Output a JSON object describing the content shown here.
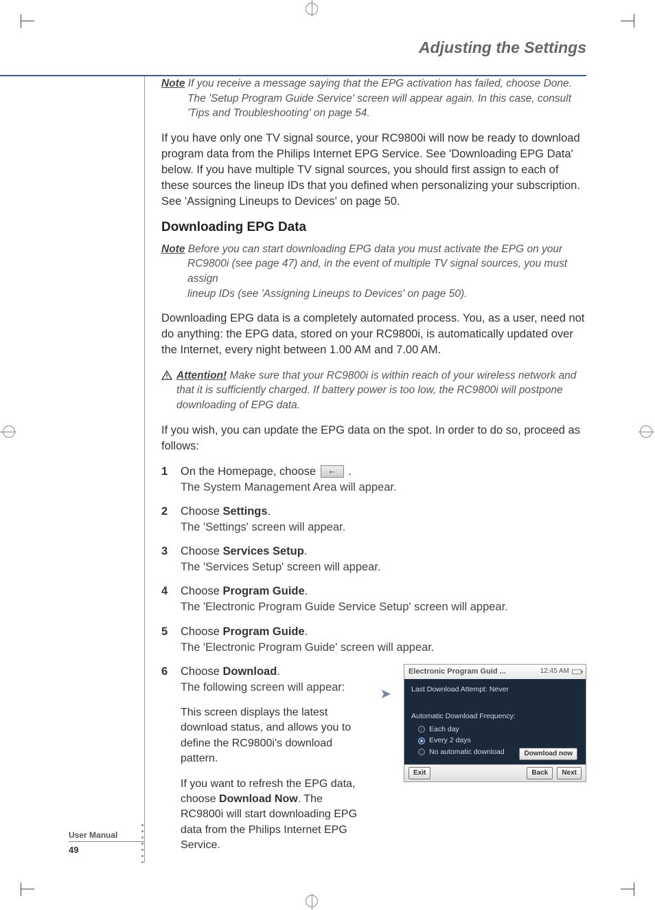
{
  "header": {
    "title": "Adjusting the Settings"
  },
  "note1": {
    "label": "Note",
    "line1": "If you receive a message saying that the EPG activation has failed, choose Done.",
    "line2": "The 'Setup Program Guide Service' screen will appear again. In this case, consult",
    "line3": "'Tips and Troubleshooting' on page 54."
  },
  "para1": "If you have only one TV signal source, your RC9800i will now be ready to download program data from the Philips Internet EPG Service. See 'Downloading EPG Data' below. If you have multiple TV signal sources, you should first assign to each of these sources the lineup IDs that you defined when personalizing your subscription. See 'Assigning Lineups to Devices' on page 50.",
  "heading": "Downloading EPG Data",
  "note2": {
    "label": "Note",
    "line1": "Before you can start downloading EPG data you must activate the EPG on your",
    "line2": "RC9800i (see page 47) and, in the event of multiple TV signal sources, you must assign",
    "line3": "lineup IDs (see 'Assigning Lineups to Devices' on page 50)."
  },
  "para2": "Downloading EPG data is a completely automated process. You, as a user, need not do anything: the EPG data, stored on your RC9800i, is automatically updated over the Internet, every night between 1.00 AM and 7.00 AM.",
  "attention": {
    "label": "Attention!",
    "text": "Make sure that your RC9800i is within reach of your wireless network and that it is sufficiently charged. If battery power is too low, the RC9800i will postpone downloading of EPG data."
  },
  "para3": "If you wish, you can update the EPG data on the spot. In order to do so, proceed as follows:",
  "steps": [
    {
      "num": "1",
      "prefix": "On the Homepage, choose ",
      "suffix": ".",
      "icon": "back-icon",
      "sub": "The System Management Area will appear."
    },
    {
      "num": "2",
      "prefix": "Choose ",
      "bold": "Settings",
      "suffix": ".",
      "sub": "The 'Settings' screen will appear."
    },
    {
      "num": "3",
      "prefix": "Choose ",
      "bold": "Services Setup",
      "suffix": ".",
      "sub": "The 'Services Setup' screen will appear."
    },
    {
      "num": "4",
      "prefix": "Choose ",
      "bold": "Program Guide",
      "suffix": ".",
      "sub": "The 'Electronic Program Guide Service Setup' screen will appear."
    },
    {
      "num": "5",
      "prefix": "Choose ",
      "bold": "Program Guide",
      "suffix": ".",
      "sub": "The 'Electronic Program Guide' screen will appear."
    },
    {
      "num": "6",
      "prefix": "Choose ",
      "bold": "Download",
      "suffix": ".",
      "sub": "The following screen will appear:",
      "extra1": "This screen displays the latest download status, and allows you to define the RC9800i's download pattern.",
      "extra2a": "If you want to refresh the EPG data, choose ",
      "extra2bold": "Download Now",
      "extra2b": ". The RC9800i will start downloading EPG data from the Philips Internet EPG Service."
    }
  ],
  "device": {
    "title": "Electronic Program Guid ...",
    "time": "12:45 AM",
    "last_attempt": "Last Download Attempt: Never",
    "freq_label": "Automatic Download Frequency:",
    "options": [
      "Each day",
      "Every 2 days",
      "No automatic download"
    ],
    "selected_index": 1,
    "download_now": "Download now",
    "exit": "Exit",
    "back": "Back",
    "next": "Next"
  },
  "footer": {
    "label": "User Manual",
    "page": "49"
  }
}
